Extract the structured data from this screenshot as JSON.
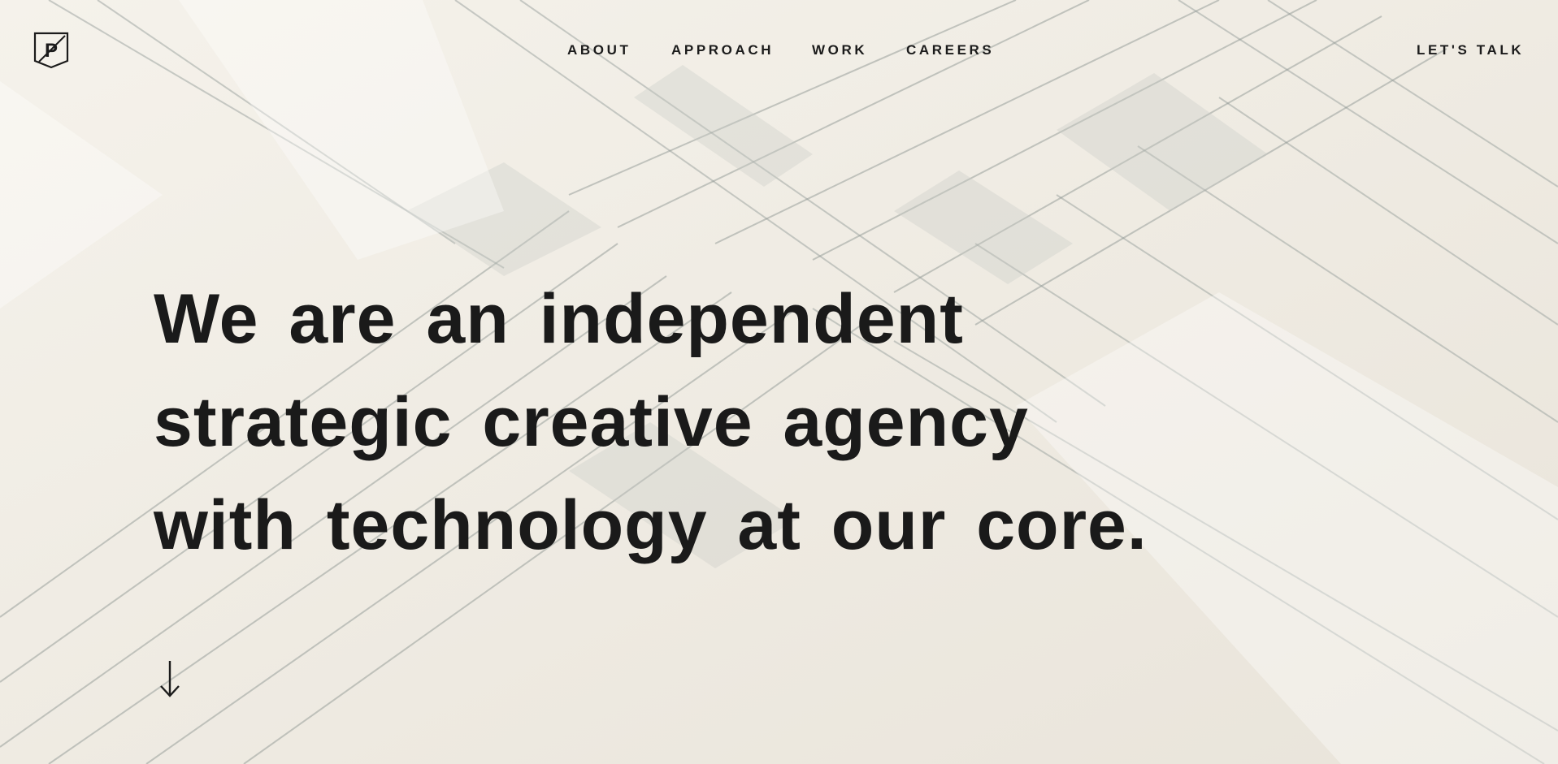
{
  "nav": {
    "logo_letter": "P",
    "items": [
      {
        "label": "ABOUT"
      },
      {
        "label": "APPROACH"
      },
      {
        "label": "WORK"
      },
      {
        "label": "CAREERS"
      }
    ],
    "cta_label": "LET'S TALK"
  },
  "hero": {
    "headline_lines": [
      "We are an independent",
      "strategic creative agency",
      "with technology at our core."
    ]
  },
  "icons": {
    "logo": "shield-p-logo-icon",
    "scroll": "arrow-down-icon"
  },
  "colors": {
    "background": "#efebe3",
    "text": "#1b1b1b",
    "shadow": "#b9beba"
  }
}
